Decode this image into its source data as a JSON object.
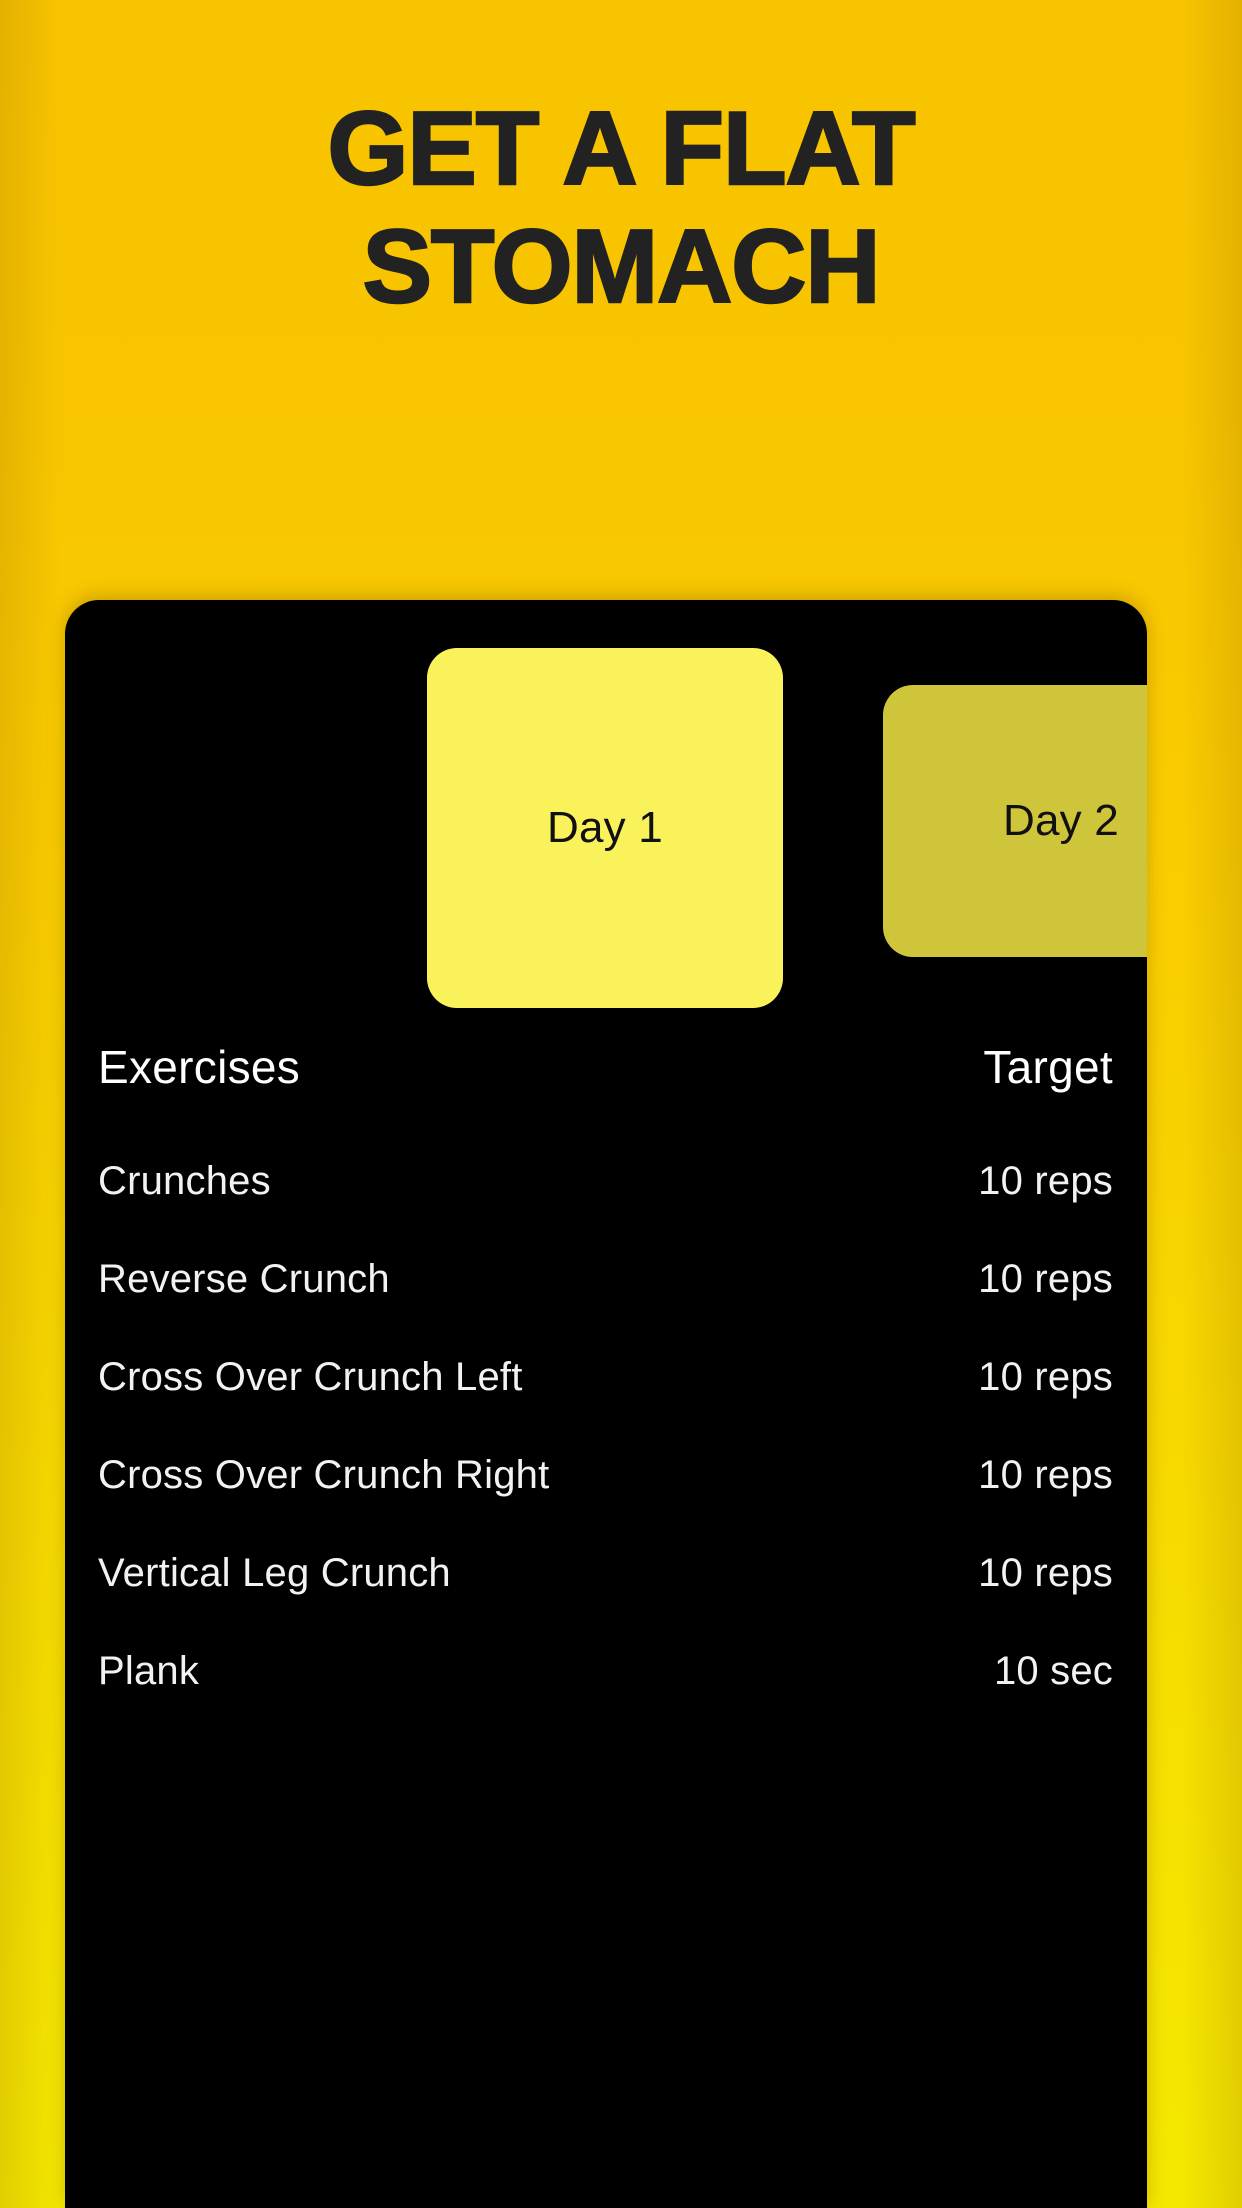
{
  "theme": {
    "background_top": "#F8C300",
    "background_bottom": "#F4E800",
    "card_background": "#000000",
    "active_tab_color": "#FAF25A",
    "inactive_tab_color": "#CEC53B",
    "heading_color": "#222222",
    "table_text_color": "#FFFFFF"
  },
  "heading": {
    "line1": "GET A FLAT",
    "line2": "STOMACH",
    "full": "GET A FLAT STOMACH"
  },
  "tabs": [
    {
      "label": "Day 1",
      "active": true
    },
    {
      "label": "Day 2",
      "active": false
    }
  ],
  "table": {
    "headers": {
      "exercises": "Exercises",
      "target": "Target"
    },
    "rows": [
      {
        "name": "Crunches",
        "target": "10 reps"
      },
      {
        "name": "Reverse Crunch",
        "target": "10 reps"
      },
      {
        "name": "Cross Over Crunch Left",
        "target": "10 reps"
      },
      {
        "name": "Cross Over Crunch Right",
        "target": "10 reps"
      },
      {
        "name": "Vertical Leg Crunch",
        "target": "10 reps"
      },
      {
        "name": "Plank",
        "target": "10 sec"
      }
    ]
  }
}
